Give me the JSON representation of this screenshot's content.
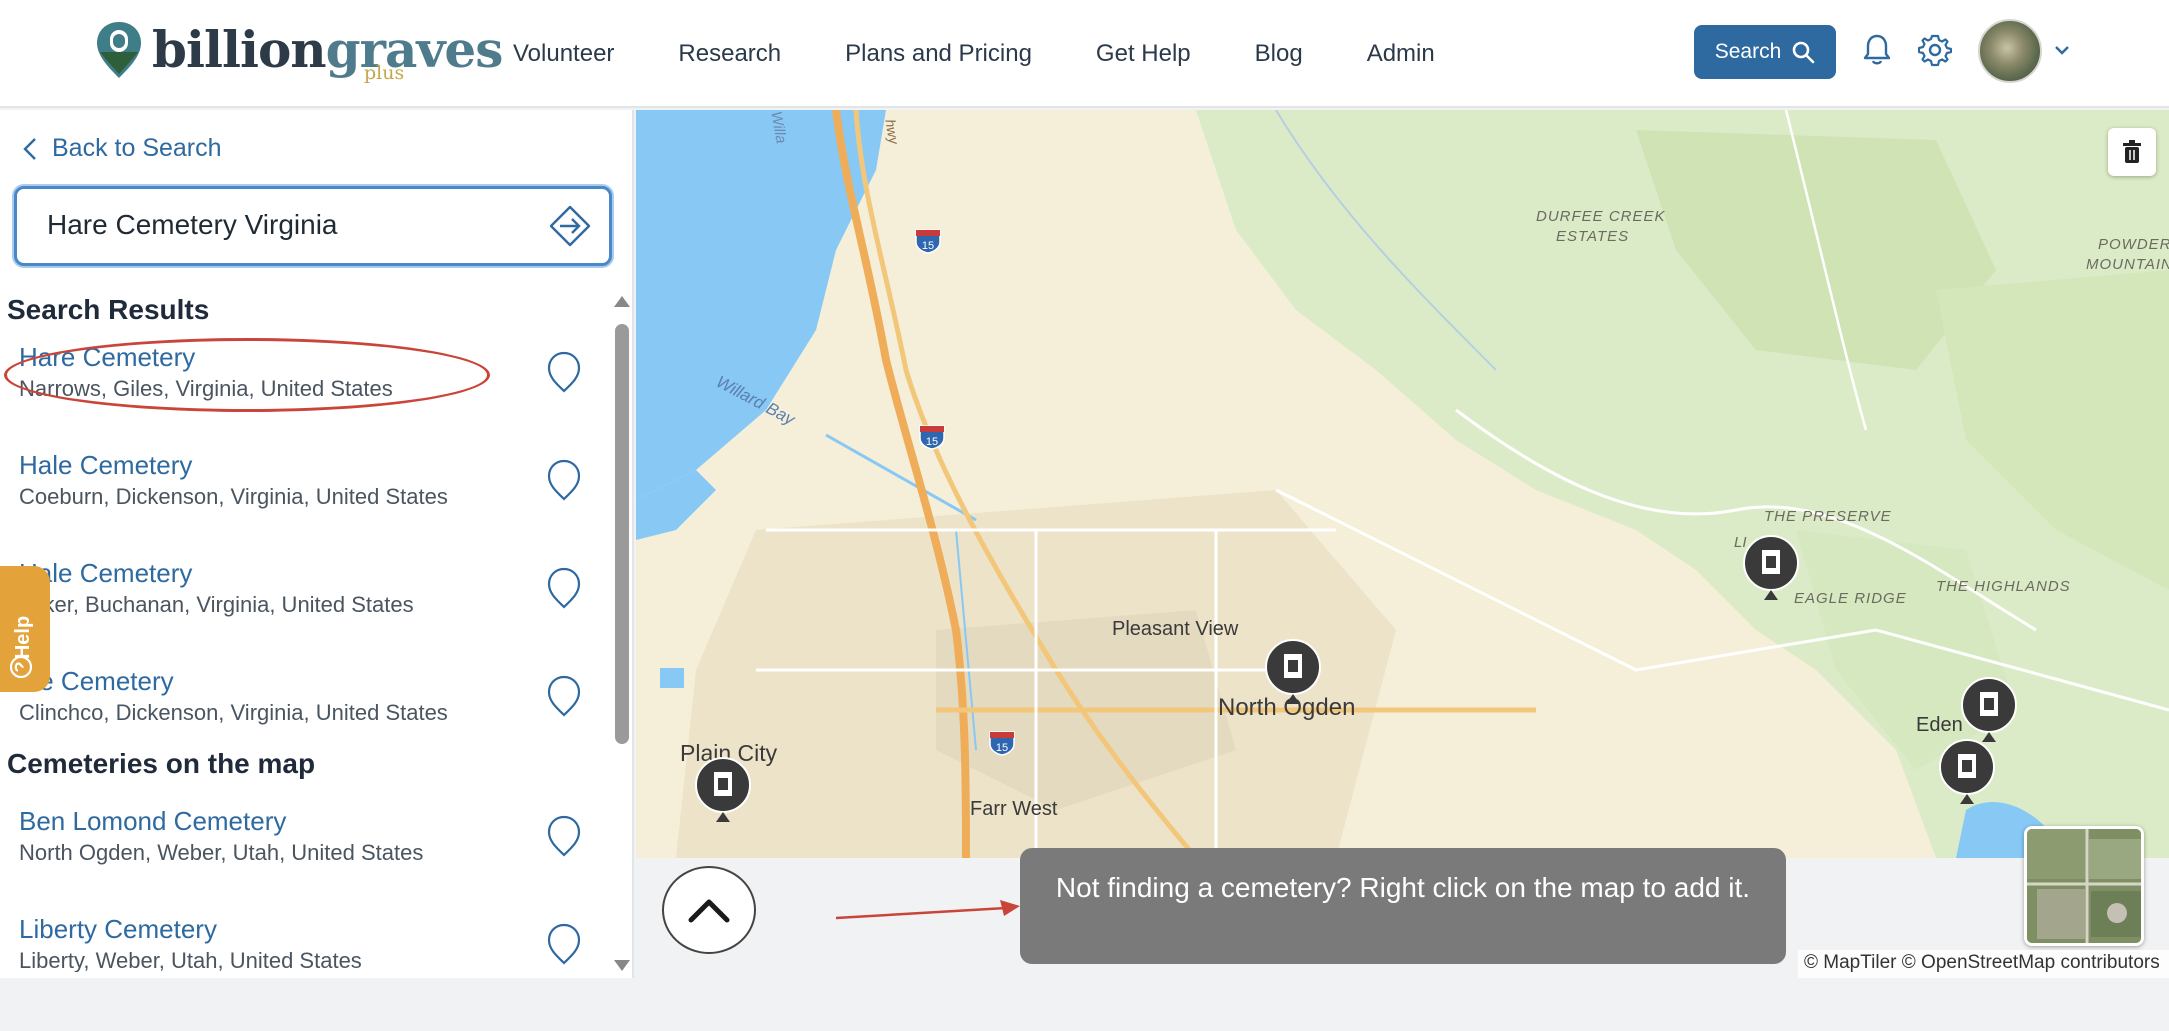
{
  "logo": {
    "word_dark": "billion",
    "word_light": "graves",
    "suffix": "plus"
  },
  "nav": {
    "items": [
      "Volunteer",
      "Research",
      "Plans and Pricing",
      "Get Help",
      "Blog",
      "Admin"
    ]
  },
  "header": {
    "search_label": "Search"
  },
  "sidebar": {
    "back_label": "Back to Search",
    "search_value": "Hare Cemetery Virginia",
    "search_results_title": "Search Results",
    "search_results": [
      {
        "name": "Hare Cemetery",
        "place": "Narrows, Giles, Virginia, United States"
      },
      {
        "name": "Hale Cemetery",
        "place": "Coeburn, Dickenson, Virginia, United States"
      },
      {
        "name": "Hale Cemetery",
        "place": "naker, Buchanan, Virginia, United States"
      },
      {
        "name": "ale Cemetery",
        "place": "Clinchco, Dickenson, Virginia, United States"
      }
    ],
    "map_section_title": "Cemeteries on the map",
    "map_results": [
      {
        "name": "Ben Lomond Cemetery",
        "place": "North Ogden, Weber, Utah, United States"
      },
      {
        "name": "Liberty Cemetery",
        "place": "Liberty, Weber, Utah, United States"
      }
    ],
    "help_label": "Help"
  },
  "map": {
    "labels": {
      "durfee": "DURFEE CREEK",
      "estates": "ESTATES",
      "powder": "POWDER",
      "mountain": "MOUNTAIN",
      "preserve": "THE PRESERVE",
      "liberty": "LI",
      "eagle_ridge": "EAGLE RIDGE",
      "highlands": "THE HIGHLANDS",
      "pleasant_view": "Pleasant View",
      "north_ogden": "North Ogden",
      "plain_city": "Plain City",
      "farr_west": "Farr West",
      "eden": "Eden",
      "willard_bay": "Willard Bay",
      "willa": "Willa",
      "hwy": "hwy",
      "i15": "15"
    },
    "tooltip": "Not finding a cemetery? Right click on the map to add it.",
    "attribution": "© MapTiler © OpenStreetMap contributors"
  },
  "colors": {
    "brand_blue": "#2e6aa0",
    "help_orange": "#e3a23a",
    "annotation_red": "#c9453a",
    "water": "#88c8f5",
    "land": "#f5efd9"
  }
}
